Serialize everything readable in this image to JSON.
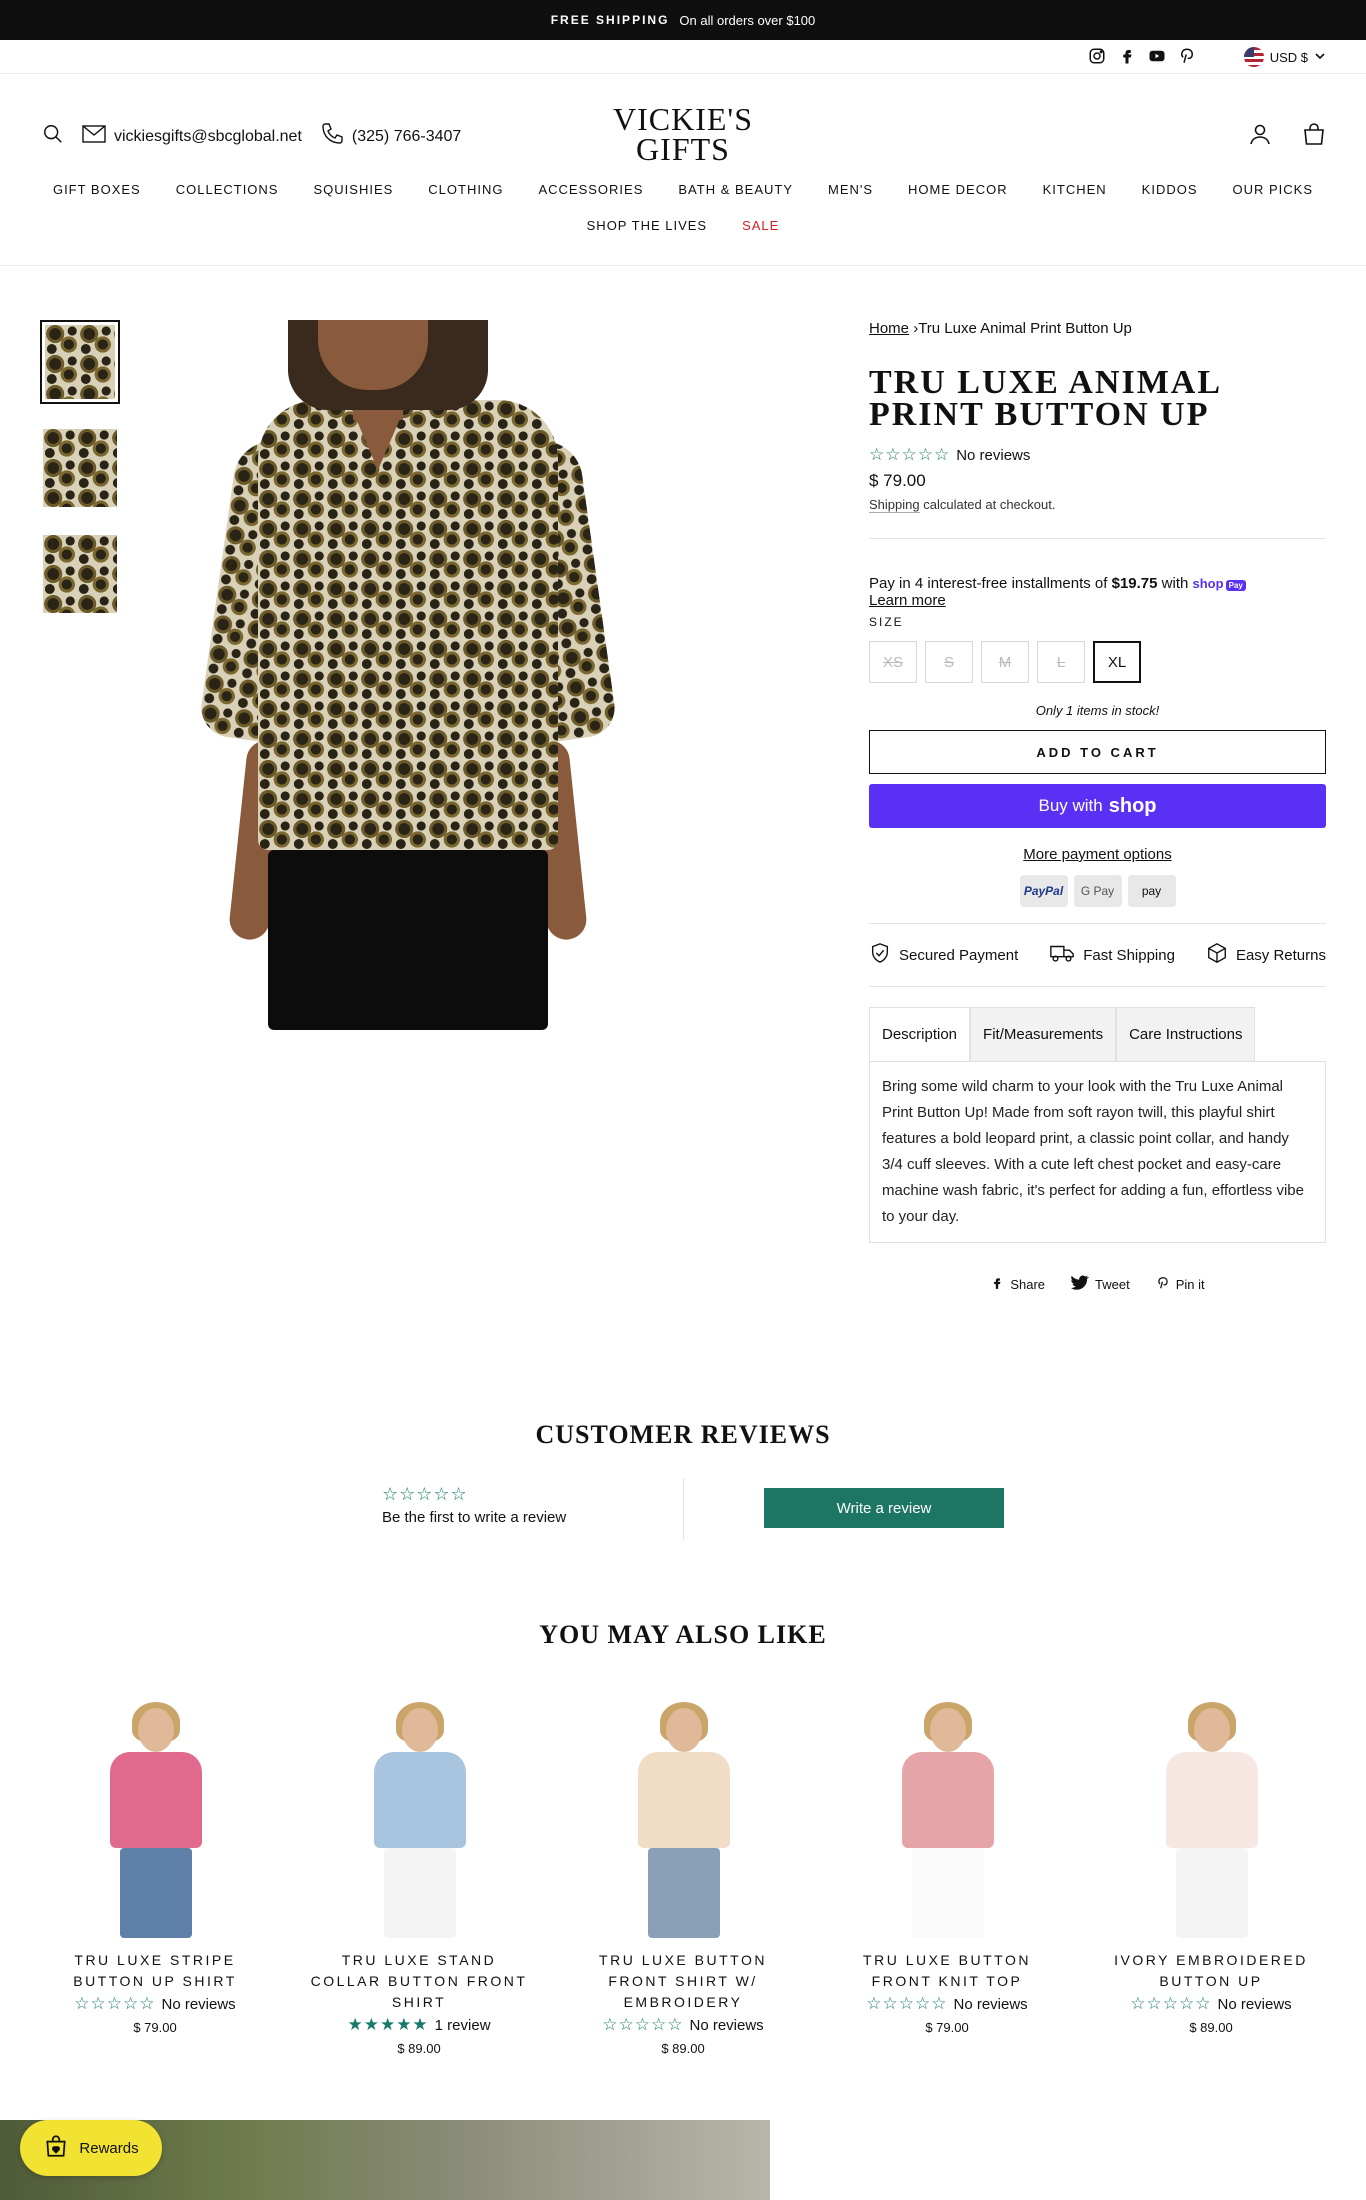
{
  "announcement": {
    "strong": "FREE SHIPPING",
    "text": "On all orders over $100"
  },
  "util": {
    "currency": "USD $",
    "socials": [
      "instagram-icon",
      "facebook-icon",
      "youtube-icon",
      "pinterest-icon"
    ]
  },
  "header": {
    "email": "vickiesgifts@sbcglobal.net",
    "phone": "(325) 766-3407",
    "logo_line1": "VICKIE'S",
    "logo_line2": "GIFTS",
    "nav": [
      "GIFT BOXES",
      "COLLECTIONS",
      "SQUISHIES",
      "CLOTHING",
      "ACCESSORIES",
      "BATH & BEAUTY",
      "MEN'S",
      "HOME DECOR",
      "KITCHEN",
      "KIDDOS",
      "OUR PICKS"
    ],
    "nav2": [
      "SHOP THE LIVES",
      "SALE"
    ]
  },
  "product": {
    "breadcrumb_home": "Home",
    "breadcrumb_sep": "›",
    "breadcrumb_current": "Tru Luxe Animal Print Button Up",
    "title": "TRU LUXE ANIMAL PRINT BUTTON UP",
    "stars": "☆☆☆☆☆",
    "reviews": "No reviews",
    "price": "$ 79.00",
    "shipping_link": "Shipping",
    "shipping_text": " calculated at checkout.",
    "installments_prefix": "Pay in 4 interest-free installments of ",
    "installments_amount": "$19.75",
    "installments_suffix": " with ",
    "shoppay_word": "shop",
    "shoppay_badge": "Pay",
    "learn_more": "Learn more",
    "size_label": "SIZE",
    "sizes": [
      "XS",
      "S",
      "M",
      "L",
      "XL"
    ],
    "stock": "Only 1 items in stock!",
    "add_to_cart": "ADD TO CART",
    "buy_with": "Buy with",
    "buy_shop": "shop",
    "more_payment": "More payment options",
    "pay_icons": [
      "PayPal",
      "G Pay",
      "pay"
    ],
    "trust": [
      "Secured Payment",
      "Fast Shipping",
      "Easy Returns"
    ],
    "tabs": [
      "Description",
      "Fit/Measurements",
      "Care Instructions"
    ],
    "description": "Bring some wild charm to your look with the Tru Luxe Animal Print Button Up! Made from soft rayon twill, this playful shirt features a bold leopard print, a classic point collar, and handy 3/4 cuff sleeves. With a cute left chest pocket and easy-care machine wash fabric, it's perfect for adding a fun, effortless vibe to your day.",
    "share": [
      "Share",
      "Tweet",
      "Pin it"
    ]
  },
  "reviews": {
    "title": "CUSTOMER REVIEWS",
    "stars": "☆☆☆☆☆",
    "first": "Be the first to write a review",
    "button": "Write a review"
  },
  "recommended": {
    "title": "YOU MAY ALSO LIKE",
    "items": [
      {
        "name": "TRU LUXE STRIPE BUTTON UP SHIRT",
        "stars": "☆☆☆☆☆",
        "reviews": "No reviews",
        "price": "$ 79.00",
        "top": "#e06a8e",
        "bottom": "#5d7fa8"
      },
      {
        "name": "TRU LUXE STAND COLLAR BUTTON FRONT SHIRT",
        "stars": "★★★★★",
        "reviews": "1 review",
        "price": "$ 89.00",
        "top": "#a9c4df",
        "bottom": "#f4f4f4"
      },
      {
        "name": "TRU LUXE BUTTON FRONT SHIRT W/ EMBROIDERY",
        "stars": "☆☆☆☆☆",
        "reviews": "No reviews",
        "price": "$ 89.00",
        "top": "#f1dcc6",
        "bottom": "#8aa0b6"
      },
      {
        "name": "TRU LUXE BUTTON FRONT KNIT TOP",
        "stars": "☆☆☆☆☆",
        "reviews": "No reviews",
        "price": "$ 79.00",
        "top": "#e5a4a8",
        "bottom": "#fafafa"
      },
      {
        "name": "IVORY EMBROIDERED BUTTON UP",
        "stars": "☆☆☆☆☆",
        "reviews": "No reviews",
        "price": "$ 89.00",
        "top": "#f6e7e2",
        "bottom": "#f4f4f4"
      }
    ]
  },
  "rewards": {
    "label": "Rewards"
  },
  "colors": {
    "accent_green": "#1d7564",
    "shop_pay": "#5a31f4",
    "sale": "#d21f1f",
    "rewards": "#f2e231"
  }
}
